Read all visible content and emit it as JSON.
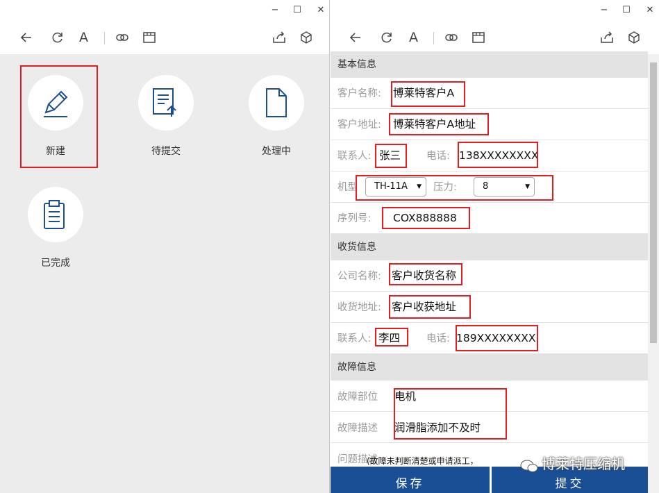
{
  "window_controls": {
    "minimize": "−",
    "maximize": "☐",
    "close": "✕"
  },
  "toolbar_icons": [
    "back-icon",
    "refresh-icon",
    "font-icon",
    "link-icon",
    "window-icon",
    "share-icon",
    "box-icon"
  ],
  "toolbar_font_glyph": "A",
  "left": {
    "tiles": [
      {
        "label": "新建",
        "icon": "pencil-icon"
      },
      {
        "label": "待提交",
        "icon": "document-upload-icon"
      },
      {
        "label": "处理中",
        "icon": "document-icon"
      },
      {
        "label": "已完成",
        "icon": "clipboard-icon"
      }
    ]
  },
  "form": {
    "sections": {
      "basic": "基本信息",
      "shipping": "收货信息",
      "fault": "故障信息"
    },
    "basic": {
      "customer_name_label": "客户名称:",
      "customer_name": "博莱特客户A",
      "customer_address_label": "客户地址:",
      "customer_address": "博莱特客户A地址",
      "contact_label": "联系人:",
      "contact": "张三",
      "phone_label": "电话:",
      "phone": "138XXXXXXXX",
      "model_label": "机型",
      "model": "TH-11A",
      "pressure_label": "压力:",
      "pressure": "8",
      "serial_label": "序列号:",
      "serial": "COX888888"
    },
    "shipping": {
      "company_label": "公司名称:",
      "company": "客户收货名称",
      "address_label": "收货地址:",
      "address": "客户收获地址",
      "contact_label": "联系人:",
      "contact": "李四",
      "phone_label": "电话:",
      "phone": "189XXXXXXXX"
    },
    "fault": {
      "part_label": "故障部位",
      "part": "电机",
      "desc_label": "故障描述",
      "desc": "润滑脂添加不及时",
      "problem_label": "问题描述",
      "problem_hint": "(故障未判断清楚或申请派工，"
    }
  },
  "buttons": {
    "save": "保存",
    "submit": "提交"
  },
  "watermark": "博莱特压缩机",
  "colors": {
    "accent": "#1a4f95",
    "highlight_box": "#e02020",
    "icon_blue": "#1f4e8c"
  }
}
